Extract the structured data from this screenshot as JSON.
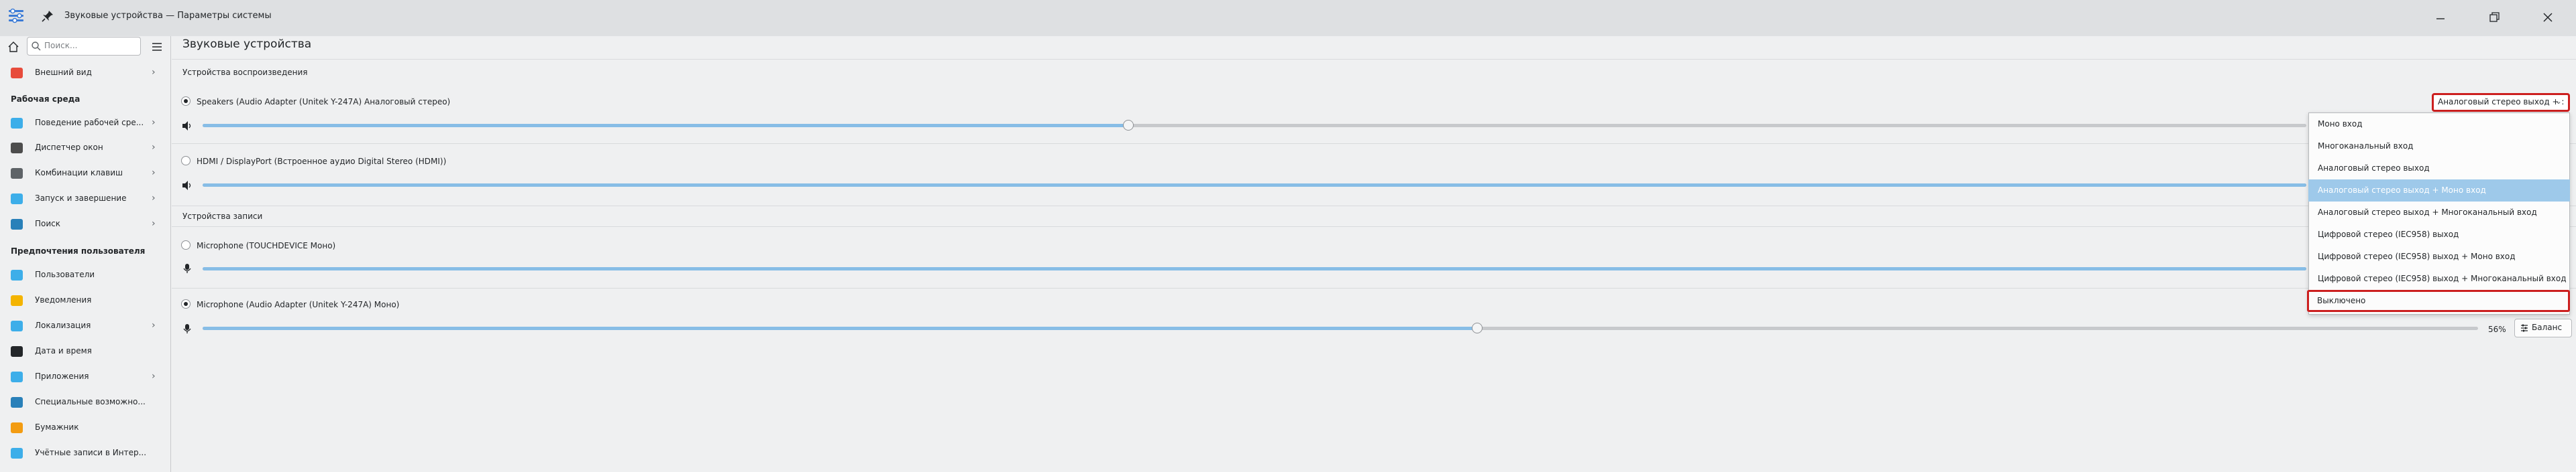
{
  "window": {
    "title": "Звуковые устройства — Параметры системы"
  },
  "sidebar": {
    "search_placeholder": "Поиск...",
    "items": [
      {
        "label": "Внешний вид",
        "icon": "appearance-icon",
        "chevron": true
      },
      {
        "label": "Поведение рабочей сре...",
        "icon": "workspace-behavior-icon",
        "chevron": true
      },
      {
        "label": "Диспетчер окон",
        "icon": "window-manager-icon",
        "chevron": true
      },
      {
        "label": "Комбинации клавиш",
        "icon": "keyboard-shortcuts-icon",
        "chevron": true
      },
      {
        "label": "Запуск и завершение",
        "icon": "startup-shutdown-icon",
        "chevron": true
      },
      {
        "label": "Поиск",
        "icon": "search-settings-icon",
        "chevron": true
      },
      {
        "label": "Пользователи",
        "icon": "users-icon",
        "chevron": false
      },
      {
        "label": "Уведомления",
        "icon": "notifications-icon",
        "chevron": false
      },
      {
        "label": "Локализация",
        "icon": "localization-icon",
        "chevron": true
      },
      {
        "label": "Дата и время",
        "icon": "date-time-icon",
        "chevron": false
      },
      {
        "label": "Приложения",
        "icon": "applications-icon",
        "chevron": true
      },
      {
        "label": "Специальные возможно...",
        "icon": "accessibility-icon",
        "chevron": false
      },
      {
        "label": "Бумажник",
        "icon": "wallet-icon",
        "chevron": false
      },
      {
        "label": "Учётные записи в Интер...",
        "icon": "online-accounts-icon",
        "chevron": false
      }
    ],
    "sections": {
      "workspace": "Рабочая среда",
      "personalization": "Предпочтения пользователя"
    }
  },
  "main": {
    "title": "Звуковые устройства",
    "playback_header": "Устройства воспроизведения",
    "recording_header": "Устройства записи",
    "playback": [
      {
        "label": "Speakers (Audio Adapter (Unitek Y-247A) Аналоговый стерео)",
        "selected": true,
        "volume_fraction": 0.44
      },
      {
        "label": "HDMI / DisplayPort (Встроенное аудио Digital Stereo (HDMI))",
        "selected": false,
        "volume_fraction": 1.0
      }
    ],
    "recording": [
      {
        "label": "Microphone (TOUCHDEVICE Моно)",
        "selected": false,
        "volume_fraction": 1.0
      },
      {
        "label": "Microphone (Audio Adapter (Unitek Y-247A) Моно)",
        "selected": true,
        "volume_fraction": 0.56
      }
    ],
    "profile_combo": {
      "value": "Аналоговый стерео выход + :",
      "options": [
        "Моно вход",
        "Многоканальный вход",
        "Аналоговый стерео выход",
        "Аналоговый стерео выход + Моно вход",
        "Аналоговый стерео выход + Многоканальный вход",
        "Цифровой стерео (IEC958) выход",
        "Цифровой стерео (IEC958) выход + Моно вход",
        "Цифровой стерео (IEC958) выход + Многоканальный вход",
        "Выключено"
      ],
      "selected_index": 3,
      "highlighted_index": 8
    },
    "mic_percent": "56%",
    "balance_label": "Баланс"
  },
  "colors": {
    "accent": "#87bde6",
    "selection": "#9ec9ea",
    "highlight_box": "#cc1f1f"
  }
}
